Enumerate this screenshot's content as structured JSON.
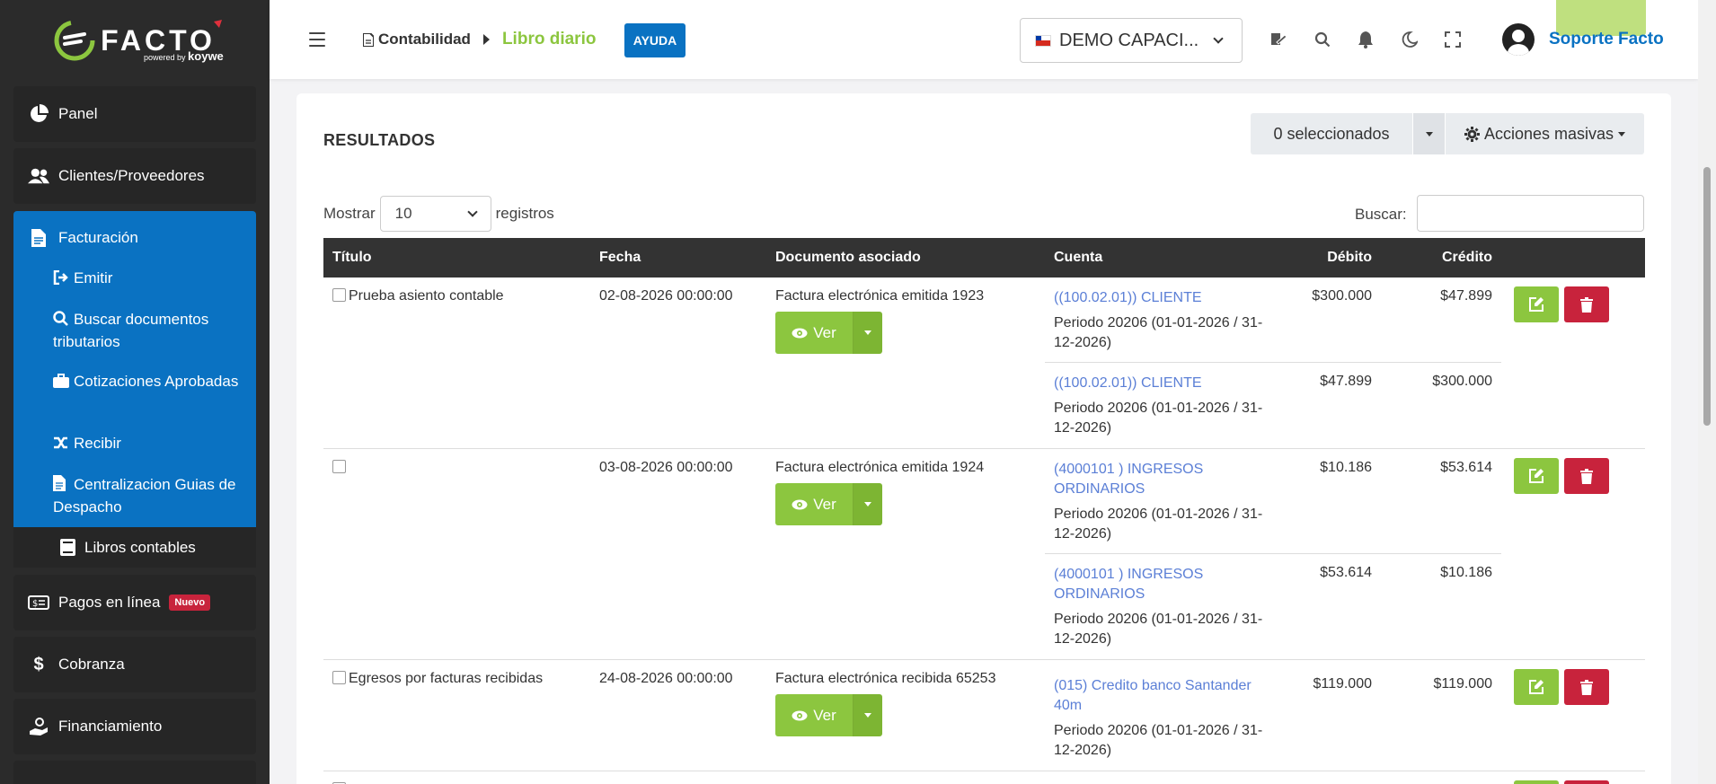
{
  "app": {
    "logo_text": "FACTO",
    "logo_sub_powered": "powered by",
    "logo_sub_brand": "koywe"
  },
  "sidebar": {
    "panel": "Panel",
    "clientes": "Clientes/Proveedores",
    "facturacion": "Facturación",
    "sub_items": [
      {
        "label": "Emitir"
      },
      {
        "label": "Buscar documentos tributarios"
      },
      {
        "label": "Cotizaciones Aprobadas"
      },
      {
        "label": "Recibir"
      },
      {
        "label": "Centralizacion Guias de Despacho"
      }
    ],
    "libros": "Libros contables",
    "pagos": "Pagos en línea",
    "pagos_badge": "Nuevo",
    "cobranza": "Cobranza",
    "financiamiento": "Financiamiento"
  },
  "header": {
    "breadcrumb_section": "Contabilidad",
    "breadcrumb_page": "Libro diario",
    "help_label": "AYUDA",
    "company": "DEMO CAPACI...",
    "user": "Soporte Facto"
  },
  "main": {
    "title": "RESULTADOS",
    "selected_label": "0 seleccionados",
    "bulk_actions": "Acciones masivas",
    "show_label": "Mostrar",
    "show_value": "10",
    "records_label": "registros",
    "search_label": "Buscar:",
    "search_value": ""
  },
  "table": {
    "headers": [
      "Título",
      "Fecha",
      "Documento asociado",
      "Cuenta",
      "Débito",
      "Crédito"
    ],
    "ver_label": "Ver",
    "rows": [
      {
        "titulo": "Prueba asiento contable",
        "fecha": "02-08-2026 00:00:00",
        "documento": "Factura electrónica emitida 1923",
        "lines": [
          {
            "cuenta": "((100.02.01)) CLIENTE",
            "periodo": "Periodo 20206 (01-01-2026 / 31-12-2026)",
            "debito": "$300.000",
            "credito": "$47.899"
          },
          {
            "cuenta": "((100.02.01)) CLIENTE",
            "periodo": "Periodo 20206 (01-01-2026 / 31-12-2026)",
            "debito": "$47.899",
            "credito": "$300.000"
          }
        ]
      },
      {
        "titulo": "",
        "fecha": "03-08-2026 00:00:00",
        "documento": "Factura electrónica emitida 1924",
        "lines": [
          {
            "cuenta": "(4000101 ) INGRESOS ORDINARIOS",
            "periodo": "Periodo 20206 (01-01-2026 / 31-12-2026)",
            "debito": "$10.186",
            "credito": "$53.614"
          },
          {
            "cuenta": "(4000101 ) INGRESOS ORDINARIOS",
            "periodo": "Periodo 20206 (01-01-2026 / 31-12-2026)",
            "debito": "$53.614",
            "credito": "$10.186"
          }
        ]
      },
      {
        "titulo": "Egresos por facturas recibidas",
        "fecha": "24-08-2026 00:00:00",
        "documento": "Factura electrónica recibida 65253",
        "lines": [
          {
            "cuenta": "(015) Credito banco Santander 40m",
            "periodo": "Periodo 20206 (01-01-2026 / 31-12-2026)",
            "debito": "$119.000",
            "credito": "$119.000"
          }
        ]
      }
    ]
  },
  "colors": {
    "sidebar_bg": "#2b2b2b",
    "accent_blue": "#0a72c2",
    "accent_green": "#8cc63f",
    "danger_red": "#c8233c",
    "link_blue": "#5b7fd6"
  }
}
